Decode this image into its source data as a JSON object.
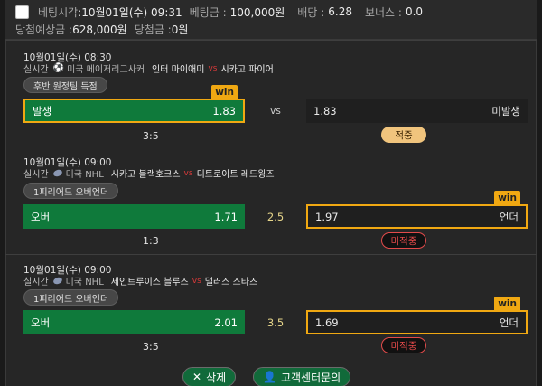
{
  "header": {
    "bet_time_label": "베팅시각",
    "bet_time_value": ":10월01일(수) 09:31",
    "bet_amount_label": "베팅금 :",
    "bet_amount_value": "100,000원",
    "odds_label": "배당 :",
    "odds_value": "6.28",
    "bonus_label": "보너스 :",
    "bonus_value": "0.0",
    "expected_label": "당첨예상금 :",
    "expected_value": "628,000원",
    "won_label": "당첨금 :",
    "won_value": "0원"
  },
  "bets": [
    {
      "time": "10월01일(수) 08:30",
      "live": "실시간",
      "sport_icon": "soccer-ball-icon",
      "league": "미국 메이저리그사커",
      "home_team": "인터 마이애미",
      "vs": "vs",
      "away_team": "시카고 파이어",
      "market": "후반 원정팀 득점",
      "home_label": "발생",
      "home_odds": "1.83",
      "mid": "vs",
      "away_odds": "1.83",
      "away_label": "미발생",
      "win_label": "win",
      "winner_side": "home",
      "score": "3:5",
      "status": "적중",
      "status_type": "hit"
    },
    {
      "time": "10월01일(수) 09:00",
      "live": "실시간",
      "sport_icon": "hockey-puck-icon",
      "league": "미국 NHL",
      "home_team": "시카고 블랙호크스",
      "vs": "vs",
      "away_team": "디트로이트 레드윙즈",
      "market": "1피리어드 오버언더",
      "home_label": "오버",
      "home_odds": "1.71",
      "mid": "2.5",
      "away_odds": "1.97",
      "away_label": "언더",
      "win_label": "win",
      "winner_side": "away",
      "score": "1:3",
      "status": "미적중",
      "status_type": "miss"
    },
    {
      "time": "10월01일(수) 09:00",
      "live": "실시간",
      "sport_icon": "hockey-puck-icon",
      "league": "미국 NHL",
      "home_team": "세인트루이스 블루즈",
      "vs": "vs",
      "away_team": "댈러스 스타즈",
      "market": "1피리어드 오버언더",
      "home_label": "오버",
      "home_odds": "2.01",
      "mid": "3.5",
      "away_odds": "1.69",
      "away_label": "언더",
      "win_label": "win",
      "winner_side": "away",
      "score": "3:5",
      "status": "미적중",
      "status_type": "miss"
    }
  ],
  "footer": {
    "delete_label": "삭제",
    "delete_icon": "close-icon",
    "support_label": "고객센터문의",
    "support_icon": "user-icon"
  },
  "colors": {
    "win_accent": "#f0a812",
    "home_green": "#0f7a3b",
    "miss_red": "#e24a4a",
    "hit_badge": "#f0c47d"
  }
}
